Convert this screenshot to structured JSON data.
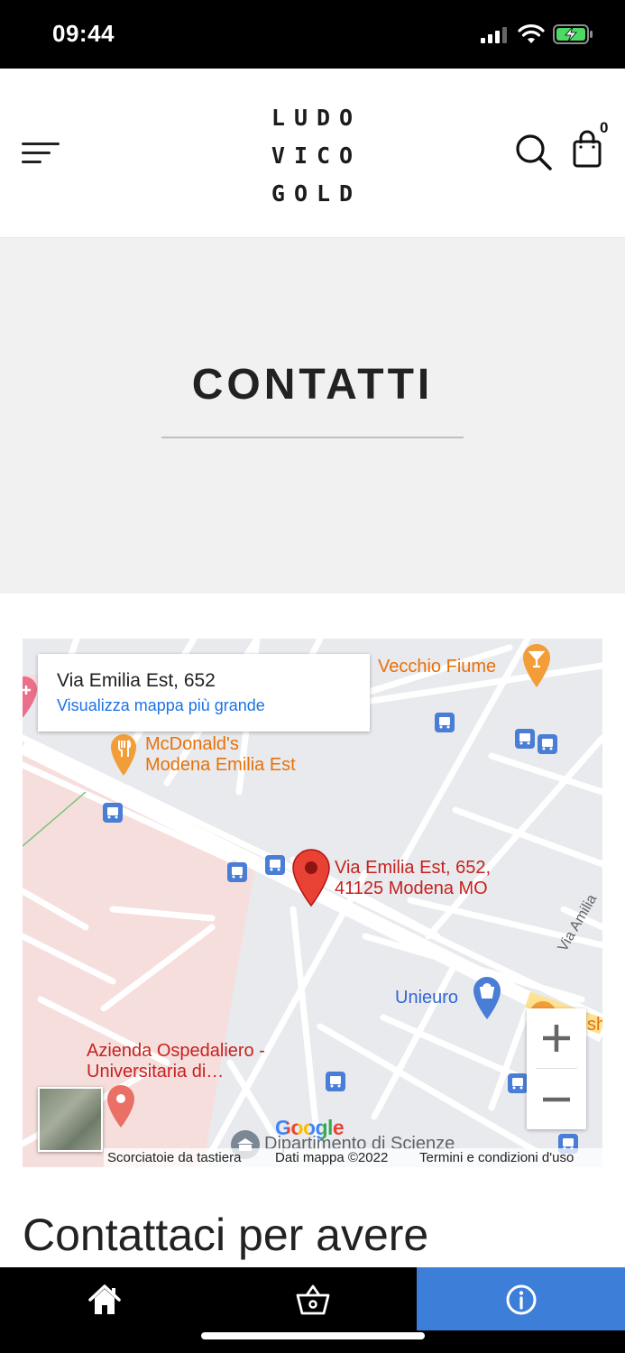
{
  "status_bar": {
    "time": "09:44"
  },
  "header": {
    "logo_lines": [
      "LUDO",
      "VICO",
      "GOLD"
    ],
    "cart_count": "0"
  },
  "hero": {
    "title": "CONTATTI"
  },
  "map": {
    "info_card": {
      "title": "Via Emilia Est, 652",
      "link": "Visualizza mappa più grande"
    },
    "labels": {
      "vecchio_fiume": "Vecchio Fiume",
      "mcdonalds_line1": "McDonald's",
      "mcdonalds_line2": "Modena Emilia Est",
      "marker_line1": "Via Emilia Est, 652,",
      "marker_line2": "41125 Modena MO",
      "unieuro": "Unieuro",
      "hospital_line1": "Azienda Ospedaliero -",
      "hospital_line2": "Universitaria di…",
      "via_amilia": "Via Amilia",
      "dipartimento": "Dipartimento di Scienze",
      "edge_sh": "sh"
    },
    "google_logo": "Google",
    "footer": {
      "shortcuts": "Scorciatoie da tastiera",
      "map_data": "Dati mappa ©2022",
      "terms": "Termini e condizioni d'uso"
    },
    "zoom_in": "+",
    "zoom_out": "−"
  },
  "contact_heading": "Contattaci per avere",
  "colors": {
    "accent_blue": "#3d7ed8",
    "map_marker": "#d93025",
    "map_link": "#1a73e8",
    "poi_orange": "#e8710a"
  },
  "bottom_nav": {
    "active": "info",
    "tabs": [
      {
        "icon": "home-icon"
      },
      {
        "icon": "basket-icon"
      },
      {
        "icon": "info-icon"
      }
    ]
  }
}
